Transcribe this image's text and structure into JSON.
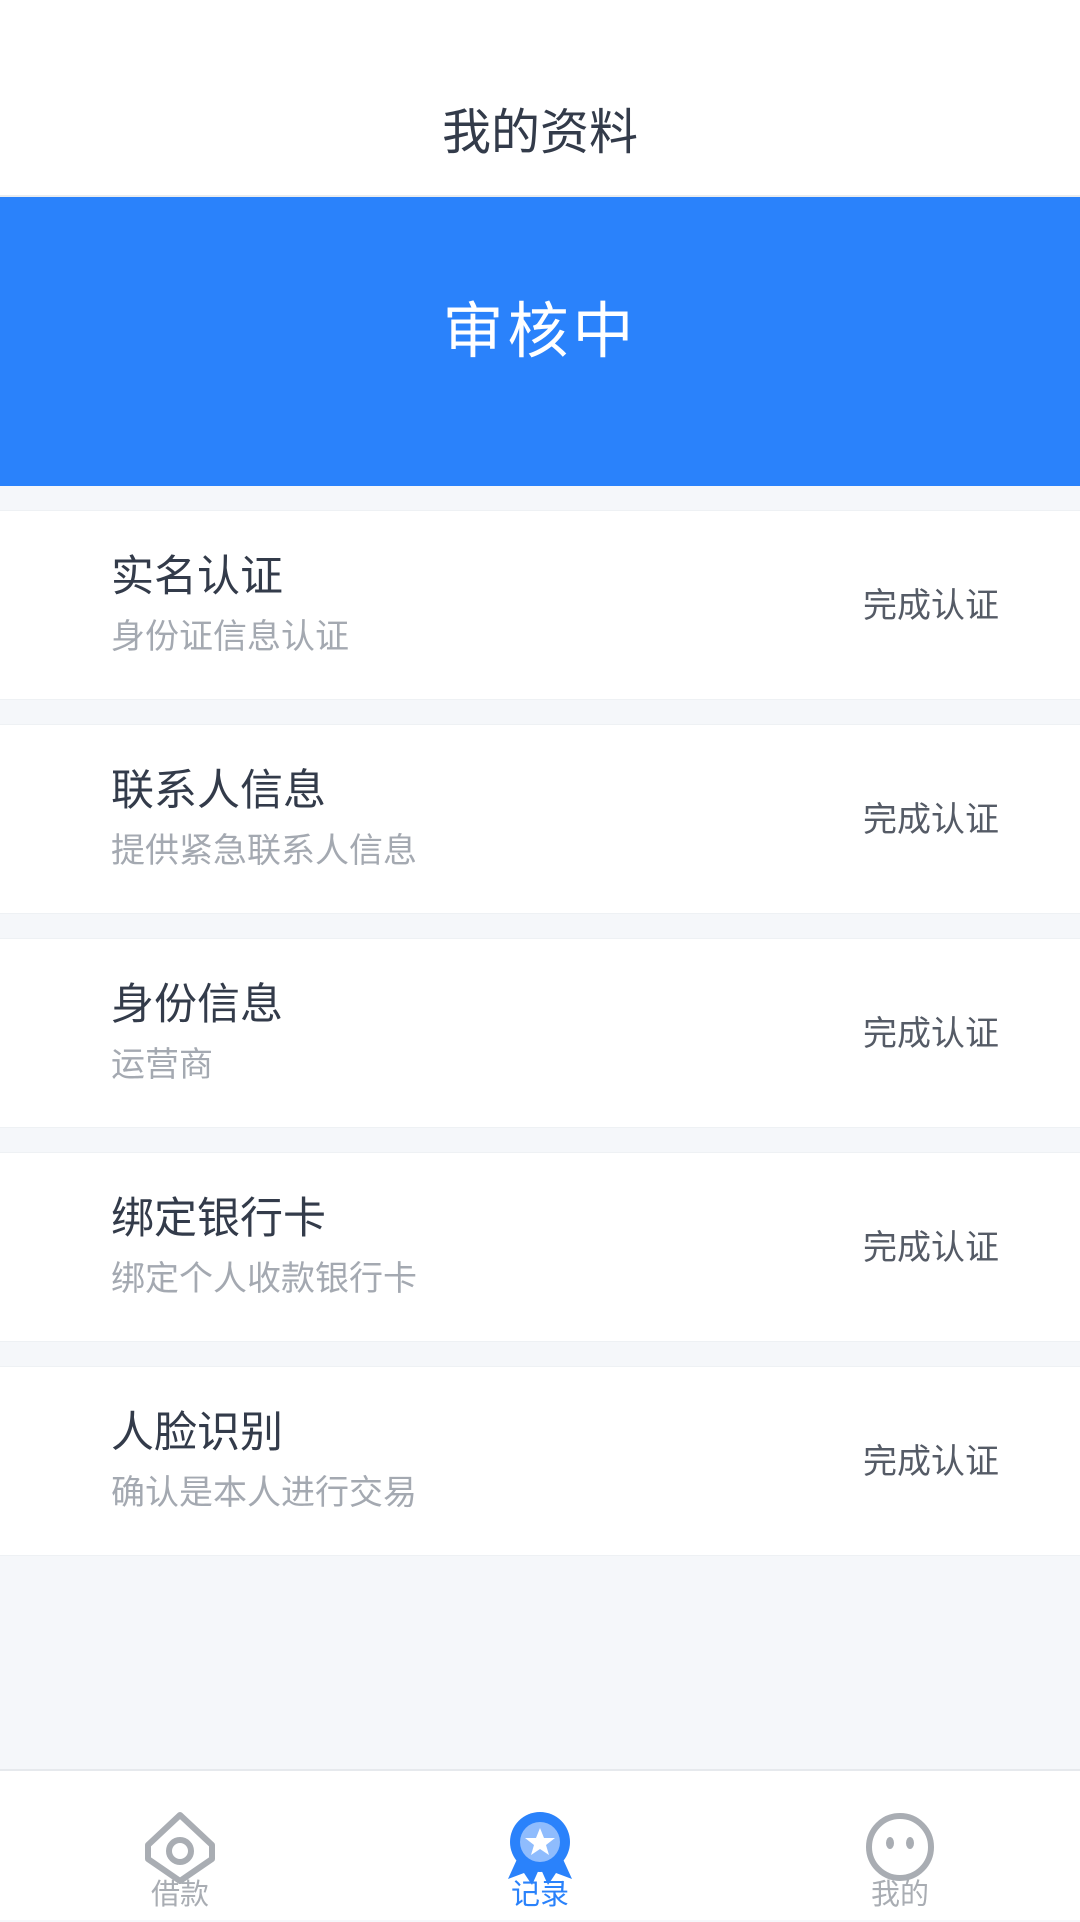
{
  "header": {
    "title": "我的资料"
  },
  "banner": {
    "status": "审核中",
    "color": "#2a82fb"
  },
  "items": [
    {
      "title": "实名认证",
      "subtitle": "身份证信息认证",
      "status": "完成认证"
    },
    {
      "title": "联系人信息",
      "subtitle": "提供紧急联系人信息",
      "status": "完成认证"
    },
    {
      "title": "身份信息",
      "subtitle": "运营商",
      "status": "完成认证"
    },
    {
      "title": "绑定银行卡",
      "subtitle": "绑定个人收款银行卡",
      "status": "完成认证"
    },
    {
      "title": "人脸识别",
      "subtitle": "确认是本人进行交易",
      "status": "完成认证"
    }
  ],
  "tabbar": {
    "active_color": "#2a82fb",
    "inactive_color": "#a9adb3",
    "tabs": [
      {
        "label": "借款",
        "icon": "home-icon",
        "active": false
      },
      {
        "label": "记录",
        "icon": "medal-icon",
        "active": true
      },
      {
        "label": "我的",
        "icon": "smiley-face-icon",
        "active": false
      }
    ]
  }
}
